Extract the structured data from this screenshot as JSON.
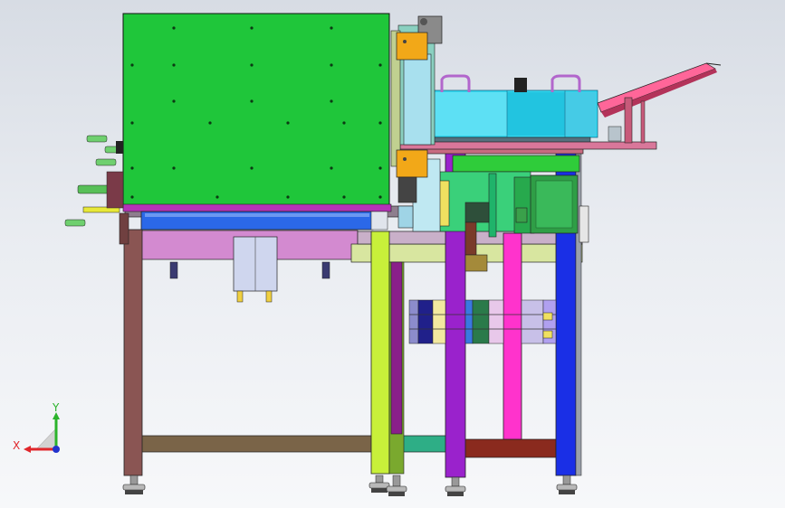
{
  "viewport": {
    "title": "",
    "background_top": "#d7dce4",
    "background_bottom": "#f7f8fa"
  },
  "triad": {
    "x_label": "X",
    "y_label": "Y",
    "x_color": "#e0262b",
    "y_color": "#2bb32b",
    "z_color": "#2233cc"
  },
  "palette": {
    "upper_box": "#1fc63a",
    "leg_frame": "#7a4848",
    "left_post": "#8a5553",
    "purple_post": "#9a22cc",
    "blue_post": "#1a2fe6",
    "magenta_post": "#ff33cc",
    "lime_post": "#c8f03a",
    "top_plate": "#d9779a",
    "bowl": "#33d6ee",
    "chute": "#ff6699",
    "base_rail": "#6e5a3c",
    "shaft": "#2fb89a"
  }
}
